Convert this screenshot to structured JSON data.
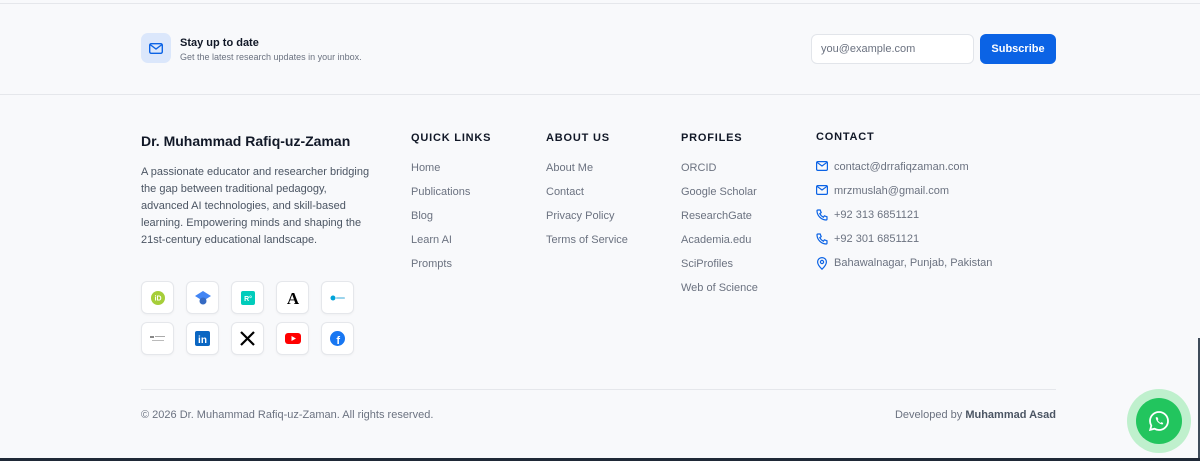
{
  "newsletter": {
    "title": "Stay up to date",
    "subtitle": "Get the latest research updates in your inbox.",
    "email_placeholder": "you@example.com",
    "subscribe_label": "Subscribe",
    "icon": "mail-icon"
  },
  "brand": {
    "name": "Dr. Muhammad Rafiq-uz-Zaman",
    "description": "A passionate educator and researcher bridging the gap between traditional pedagogy, advanced AI technologies, and skill-based learning. Empowering minds and shaping the 21st-century educational landscape."
  },
  "socials": [
    {
      "name": "orcid-icon",
      "color": "#a6ce39"
    },
    {
      "name": "google-scholar-icon",
      "color": "#4285f4"
    },
    {
      "name": "researchgate-icon",
      "color": "#00ccbb",
      "text": "R°"
    },
    {
      "name": "academia-icon",
      "color": "#000000",
      "text": "A"
    },
    {
      "name": "sciprofiles-icon",
      "color": "#00a3d9"
    },
    {
      "name": "web-of-science-icon",
      "color": "#555555"
    },
    {
      "name": "linkedin-icon",
      "color": "#0a66c2",
      "text": "in"
    },
    {
      "name": "x-icon",
      "color": "#000000",
      "text": "X"
    },
    {
      "name": "youtube-icon",
      "color": "#ff0000"
    },
    {
      "name": "facebook-icon",
      "color": "#1877f2",
      "text": "f"
    }
  ],
  "quick_links": {
    "title": "QUICK LINKS",
    "items": [
      "Home",
      "Publications",
      "Blog",
      "Learn AI",
      "Prompts"
    ]
  },
  "about_us": {
    "title": "ABOUT US",
    "items": [
      "About Me",
      "Contact",
      "Privacy Policy",
      "Terms of Service"
    ]
  },
  "profiles": {
    "title": "PROFILES",
    "items": [
      "ORCID",
      "Google Scholar",
      "ResearchGate",
      "Academia.edu",
      "SciProfiles",
      "Web of Science"
    ]
  },
  "contact": {
    "title": "CONTACT",
    "items": [
      {
        "icon": "mail-icon",
        "text": "contact@drrafiqzaman.com"
      },
      {
        "icon": "mail-icon",
        "text": "mrzmuslah@gmail.com"
      },
      {
        "icon": "phone-icon",
        "text": "+92 313 6851121"
      },
      {
        "icon": "phone-icon",
        "text": "+92 301 6851121"
      },
      {
        "icon": "location-pin-icon",
        "text": "Bahawalnagar, Punjab, Pakistan"
      }
    ]
  },
  "footer": {
    "copyright": "© 2026 Dr. Muhammad Rafiq-uz-Zaman. All rights reserved.",
    "developed_by_label": "Developed by",
    "developer_name": "Muhammad Asad"
  },
  "colors": {
    "accent": "#0b63e5",
    "whatsapp": "#22c55e"
  }
}
